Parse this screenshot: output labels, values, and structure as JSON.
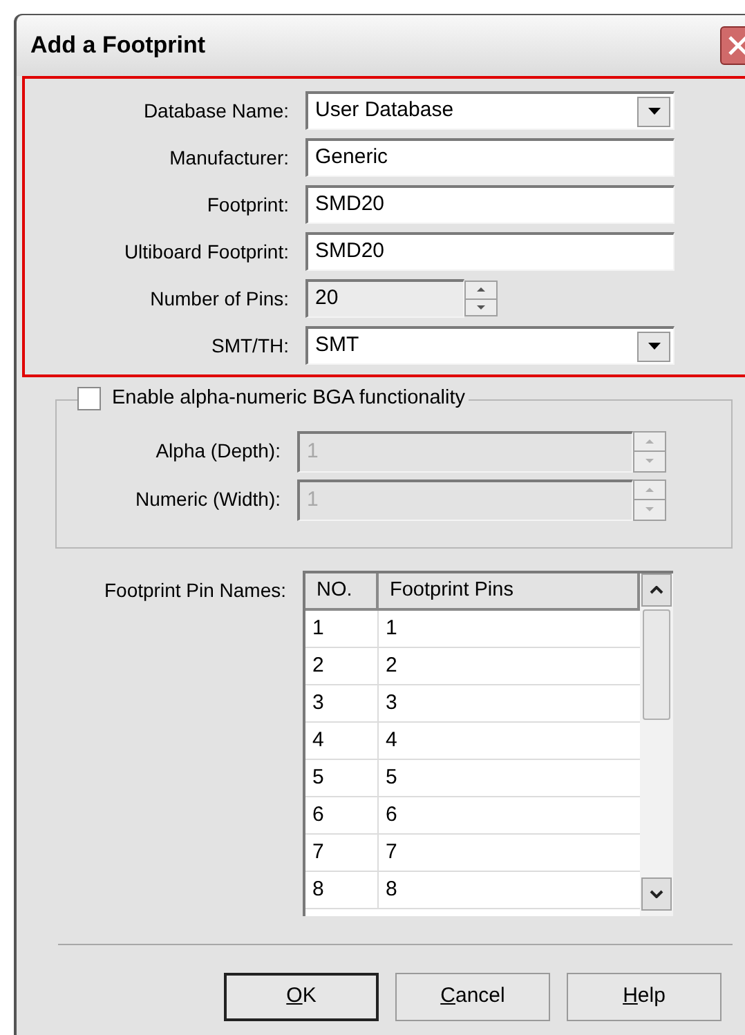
{
  "window": {
    "title": "Add a Footprint"
  },
  "fields": [
    {
      "kind": "dropdown",
      "label": "Database Name:",
      "value": "User Database",
      "read_only": false
    },
    {
      "kind": "text",
      "label": "Manufacturer:",
      "value": "Generic",
      "read_only": false
    },
    {
      "kind": "text",
      "label": "Footprint:",
      "value": "SMD20",
      "read_only": false
    },
    {
      "kind": "text",
      "label": "Ultiboard Footprint:",
      "value": "SMD20",
      "read_only": false
    },
    {
      "kind": "spinner",
      "label": "Number of Pins:",
      "value": "20",
      "read_only": true
    },
    {
      "kind": "dropdown",
      "label": "SMT/TH:",
      "value": "SMT",
      "read_only": false
    }
  ],
  "bga": {
    "label": "Enable alpha-numeric BGA functionality",
    "checked": false,
    "fields": [
      {
        "label": "Alpha (Depth):",
        "value": "1",
        "disabled": true
      },
      {
        "label": "Numeric (Width):",
        "value": "1",
        "disabled": true
      }
    ]
  },
  "pin_table": {
    "label": "Footprint Pin Names:",
    "columns": [
      "NO.",
      "Footprint Pins"
    ],
    "rows": [
      [
        "1",
        "1"
      ],
      [
        "2",
        "2"
      ],
      [
        "3",
        "3"
      ],
      [
        "4",
        "4"
      ],
      [
        "5",
        "5"
      ],
      [
        "6",
        "6"
      ],
      [
        "7",
        "7"
      ],
      [
        "8",
        "8"
      ]
    ]
  },
  "buttons": [
    {
      "label": "OK",
      "default": true,
      "underline_first": true
    },
    {
      "label": "Cancel",
      "default": false,
      "underline_first": true
    },
    {
      "label": "Help",
      "default": false,
      "underline_first": true
    }
  ]
}
